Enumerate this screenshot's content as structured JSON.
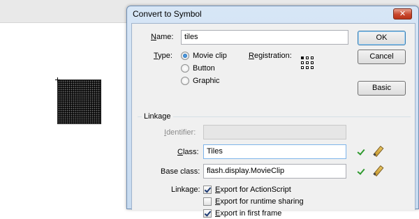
{
  "dialog": {
    "title": "Convert to Symbol",
    "close_label": "✕"
  },
  "name": {
    "label_first": "N",
    "label_rest": "ame:",
    "value": "tiles"
  },
  "type": {
    "label_first": "T",
    "label_rest": "ype:",
    "options": [
      {
        "label": "Movie clip",
        "checked": true
      },
      {
        "label": "Button",
        "checked": false
      },
      {
        "label": "Graphic",
        "checked": false
      }
    ]
  },
  "registration": {
    "label_first": "R",
    "label_rest": "egistration:"
  },
  "buttons": {
    "ok": "OK",
    "cancel": "Cancel",
    "basic": "Basic"
  },
  "linkage": {
    "legend": "Linkage",
    "identifier": {
      "label_first": "I",
      "label_rest": "dentifier:",
      "value": ""
    },
    "class": {
      "label_first": "C",
      "label_rest": "lass:",
      "value": "Tiles"
    },
    "base_class": {
      "label": "Base class:",
      "value": "flash.display.MovieClip"
    },
    "linkage_label": "Linkage:",
    "checkboxes": [
      {
        "label_first": "E",
        "label_rest": "xport for ActionScript",
        "checked": true
      },
      {
        "label_first": "E",
        "label_rest": "xport for runtime sharing",
        "checked": false
      },
      {
        "label_first": "E",
        "label_rest": "xport in first frame",
        "checked": true
      }
    ]
  }
}
